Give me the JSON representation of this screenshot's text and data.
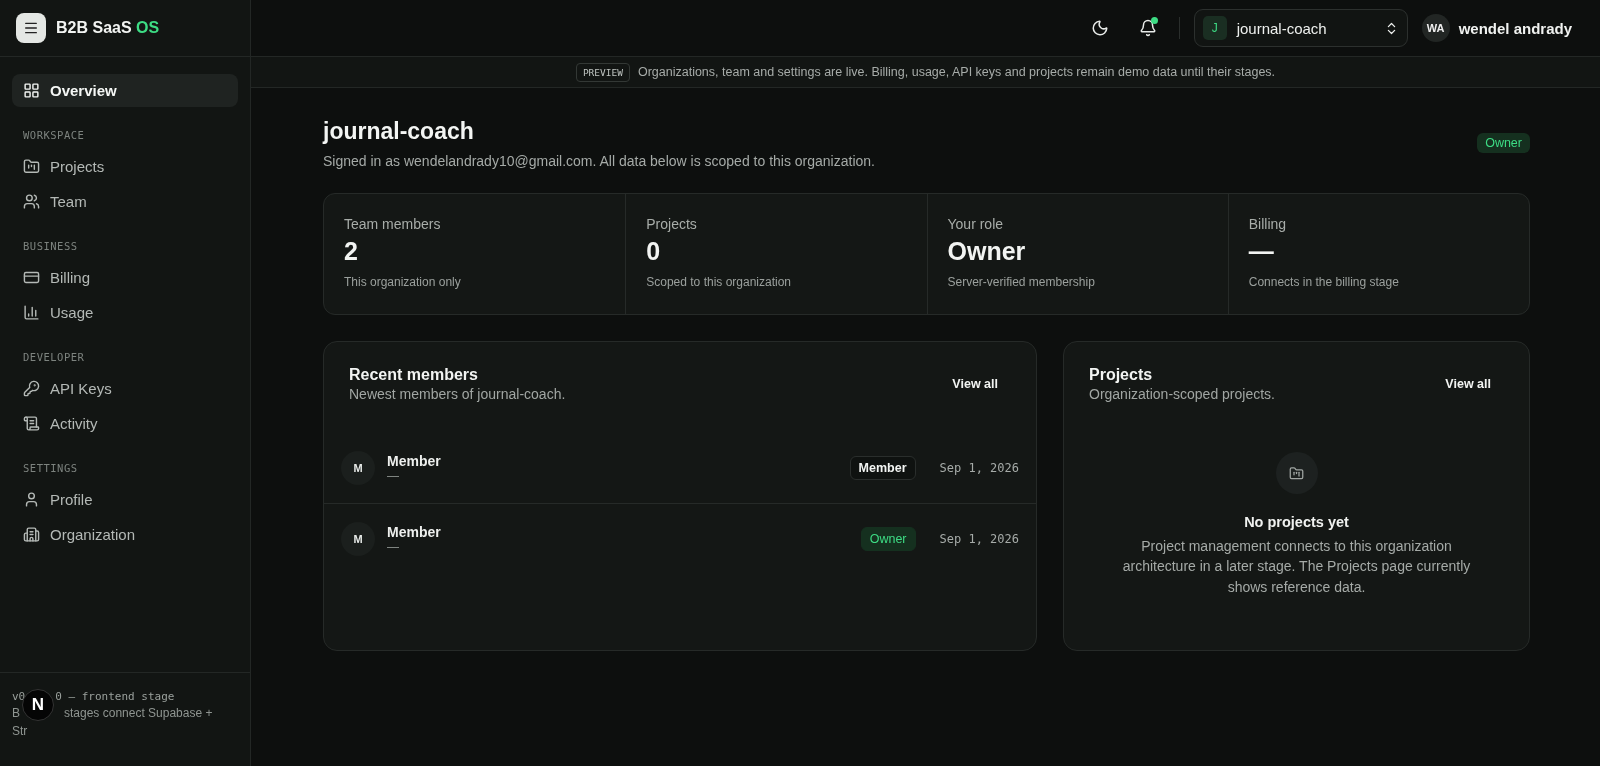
{
  "brand": {
    "name": "B2B SaaS",
    "accent": "OS"
  },
  "sidebar": {
    "items": [
      {
        "label": "Overview",
        "selected": true
      }
    ],
    "sections": [
      {
        "title": "WORKSPACE",
        "items": [
          {
            "label": "Projects",
            "selected": false
          },
          {
            "label": "Team",
            "selected": false
          }
        ]
      },
      {
        "title": "BUSINESS",
        "items": [
          {
            "label": "Billing",
            "selected": false
          },
          {
            "label": "Usage",
            "selected": false
          }
        ]
      },
      {
        "title": "DEVELOPER",
        "items": [
          {
            "label": "API Keys",
            "selected": false
          },
          {
            "label": "Activity",
            "selected": false
          }
        ]
      },
      {
        "title": "SETTINGS",
        "items": [
          {
            "label": "Profile",
            "selected": false
          },
          {
            "label": "Organization",
            "selected": false
          }
        ]
      }
    ],
    "footer": {
      "version_start": "v0",
      "version_end": "0 — frontend stage",
      "note_start": "B",
      "note_end": "stages connect Supabase +",
      "note_last": "Str",
      "badge": "N"
    }
  },
  "header": {
    "notifications_unread": true,
    "org": {
      "initial": "J",
      "name": "journal-coach"
    },
    "user": {
      "initials": "WA",
      "name": "wendel andrady"
    }
  },
  "banner": {
    "tag": "PREVIEW",
    "text": "Organizations, team and settings are live. Billing, usage, API keys and projects remain demo data until their stages."
  },
  "page": {
    "title": "journal-coach",
    "subtitle": "Signed in as wendelandrady10@gmail.com. All data below is scoped to this organization.",
    "role_badge": "Owner"
  },
  "stats": [
    {
      "label": "Team members",
      "value": "2",
      "note": "This organization only"
    },
    {
      "label": "Projects",
      "value": "0",
      "note": "Scoped to this organization"
    },
    {
      "label": "Your role",
      "value": "Owner",
      "note": "Server-verified membership"
    },
    {
      "label": "Billing",
      "value": "—",
      "note": "Connects in the billing stage"
    }
  ],
  "recent_members": {
    "title": "Recent members",
    "subtitle": "Newest members of journal-coach.",
    "action": "View all",
    "rows": [
      {
        "initial": "M",
        "name": "Member",
        "email": "—",
        "role": "Member",
        "kind": "member",
        "date": "Sep 1, 2026"
      },
      {
        "initial": "M",
        "name": "Member",
        "email": "—",
        "role": "Owner",
        "kind": "owner",
        "date": "Sep 1, 2026"
      }
    ]
  },
  "projects": {
    "title": "Projects",
    "subtitle": "Organization-scoped projects.",
    "action": "View all",
    "empty_title": "No projects yet",
    "empty_text": "Project management connects to this organization architecture in a later stage. The Projects page currently shows reference data."
  }
}
